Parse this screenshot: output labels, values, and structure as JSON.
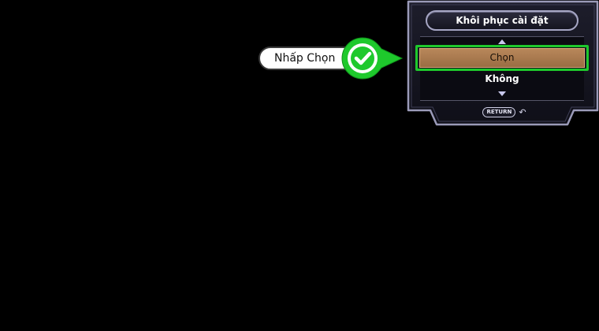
{
  "dialog": {
    "title": "Khôi phục cài đặt",
    "options": [
      {
        "label": "Chọn",
        "selected": true
      },
      {
        "label": "Không",
        "selected": false
      }
    ],
    "return_label": "RETURN",
    "return_icon": "return-arrow-icon"
  },
  "annotation": {
    "label": "Nhấp Chọn",
    "icon": "checkmark-icon",
    "highlight_color": "#1ec92c"
  },
  "colors": {
    "background": "#000000",
    "panel_border": "#9a9ab8",
    "selected_option": "#a9794d",
    "accent_green": "#1ec92c"
  }
}
